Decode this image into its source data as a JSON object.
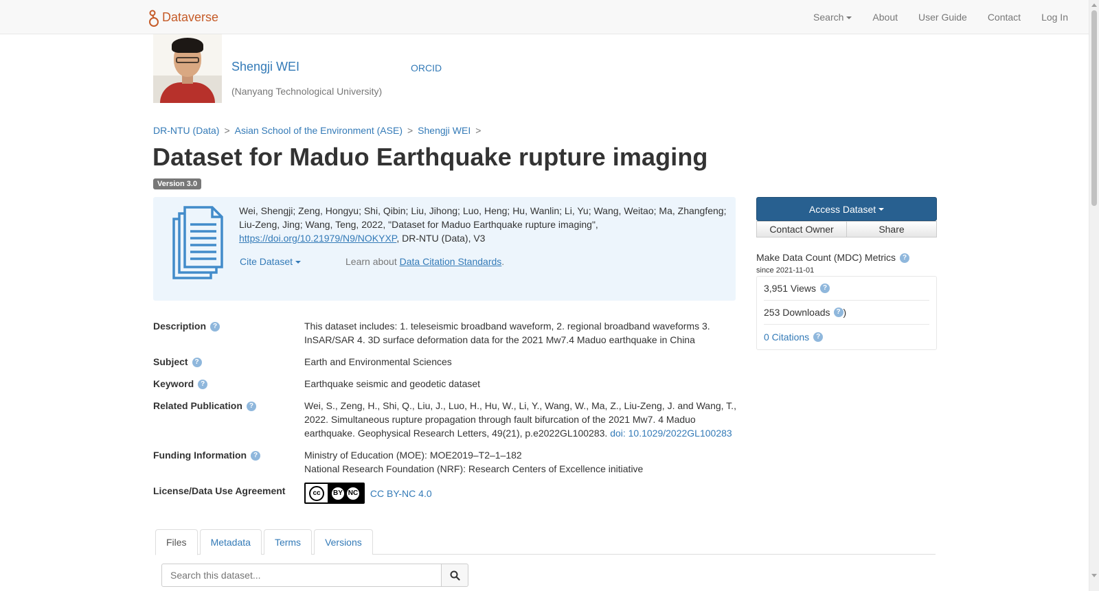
{
  "navbar": {
    "brand": "Dataverse",
    "search": "Search",
    "about": "About",
    "user_guide": "User Guide",
    "contact": "Contact",
    "login": "Log In"
  },
  "header": {
    "dataverse_name": "Shengji WEI",
    "orcid": "ORCID",
    "affiliation": "(Nanyang Technological University)"
  },
  "breadcrumb": [
    "DR-NTU (Data)",
    "Asian School of the Environment (ASE)",
    "Shengji WEI"
  ],
  "breadcrumb_sep": ">",
  "dataset": {
    "title": "Dataset for Maduo Earthquake rupture imaging",
    "version": "Version 3.0"
  },
  "citation": {
    "text_before": "Wei, Shengji; Zeng, Hongyu; Shi, Qibin; Liu, Jihong; Luo, Heng; Hu, Wanlin; Li, Yu; Wang, Weitao; Ma, Zhangfeng; Liu-Zeng, Jing; Wang, Teng, 2022, \"Dataset for Maduo Earthquake rupture imaging\", ",
    "doi_link": "https://doi.org/10.21979/N9/NOKYXP",
    "text_after": ", DR-NTU (Data), V3",
    "cite_button": "Cite Dataset",
    "learn_prefix": "Learn about ",
    "learn_link": "Data Citation Standards",
    "learn_suffix": "."
  },
  "sidebar": {
    "access": "Access Dataset",
    "contact_owner": "Contact Owner",
    "share": "Share",
    "mdc_title": "Make Data Count (MDC) Metrics",
    "mdc_since": "since 2021-11-01",
    "views": "3,951 Views",
    "downloads": "253 Downloads",
    "downloads_close": ")",
    "citations": "0 Citations"
  },
  "metadata": {
    "description_label": "Description",
    "description": "This dataset includes: 1. teleseismic broadband waveform, 2. regional broadband waveforms 3. InSAR/SAR 4. 3D surface deformation data for the 2021 Mw7.4 Maduo earthquake in China",
    "subject_label": "Subject",
    "subject": "Earth and Environmental Sciences",
    "keyword_label": "Keyword",
    "keyword": "Earthquake seismic and geodetic dataset",
    "related_label": "Related Publication",
    "related": "Wei, S., Zeng, H., Shi, Q., Liu, J., Luo, H., Hu, W., Li, Y., Wang, W., Ma, Z., Liu-Zeng, J. and Wang, T., 2022. Simultaneous rupture propagation through fault bifurcation of the 2021 Mw7. 4 Maduo earthquake. Geophysical Research Letters, 49(21), p.e2022GL100283. ",
    "related_doi": "doi: 10.1029/2022GL100283",
    "funding_label": "Funding Information",
    "funding_1": "Ministry of Education (MOE): MOE2019–T2–1–182",
    "funding_2": "National Research Foundation (NRF): Research Centers of Excellence initiative",
    "license_label": "License/Data Use Agreement",
    "license_badge_cc": "cc",
    "license_badge_by": "BY",
    "license_badge_nc": "NC",
    "license": "CC BY-NC 4.0"
  },
  "tabs": [
    "Files",
    "Metadata",
    "Terms",
    "Versions"
  ],
  "files_search": {
    "placeholder": "Search this dataset..."
  },
  "colors": {
    "brand": "#c55b28",
    "link": "#337ab7",
    "primary_button": "#286090",
    "citation_bg": "#edf5fc"
  }
}
